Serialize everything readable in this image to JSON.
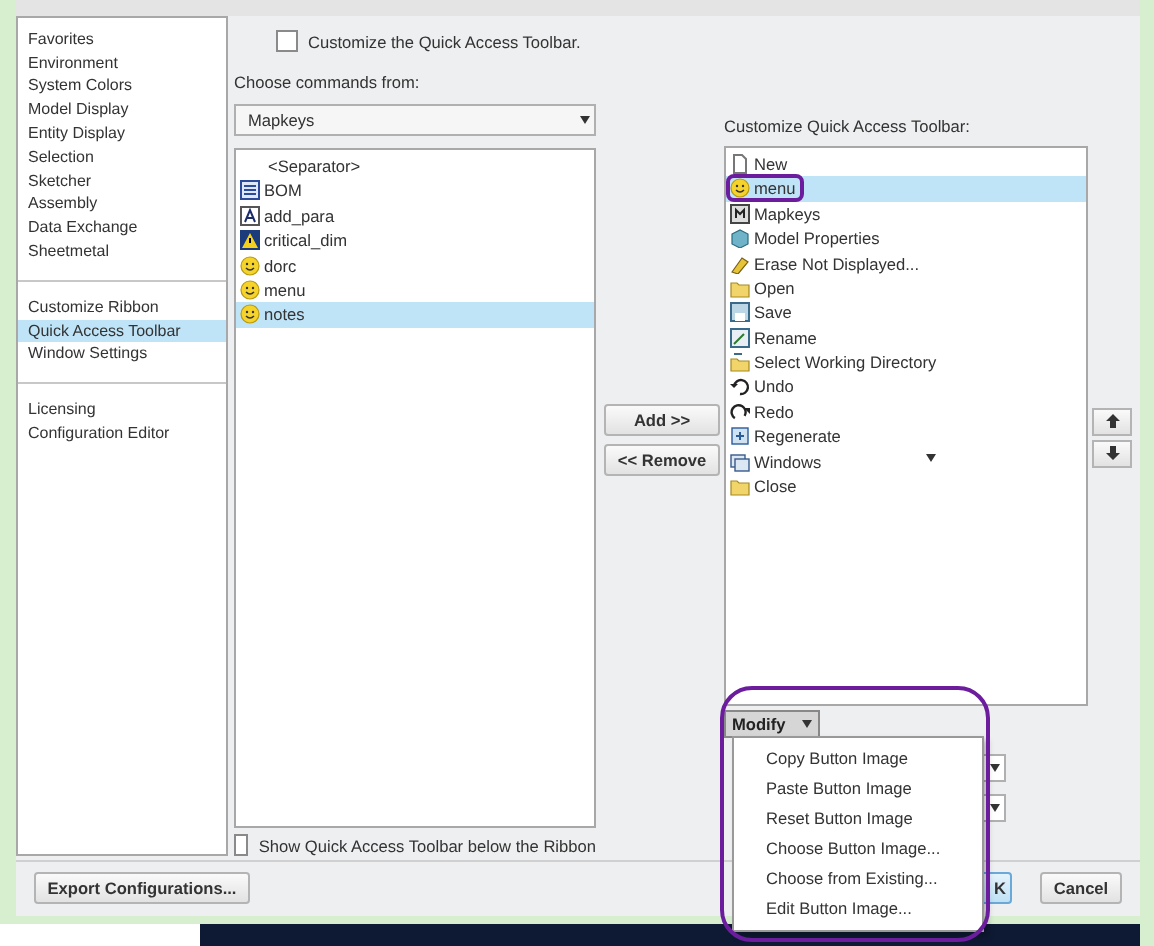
{
  "sidebar": {
    "groups": [
      {
        "items": [
          {
            "label": "Favorites",
            "selected": false
          },
          {
            "label": "Environment",
            "selected": false
          },
          {
            "label": "System Colors",
            "selected": false
          },
          {
            "label": "Model Display",
            "selected": false
          },
          {
            "label": "Entity Display",
            "selected": false
          },
          {
            "label": "Selection",
            "selected": false
          },
          {
            "label": "Sketcher",
            "selected": false
          },
          {
            "label": "Assembly",
            "selected": false
          },
          {
            "label": "Data Exchange",
            "selected": false
          },
          {
            "label": "Sheetmetal",
            "selected": false
          }
        ]
      },
      {
        "items": [
          {
            "label": "Customize Ribbon",
            "selected": false
          },
          {
            "label": "Quick Access Toolbar",
            "selected": true
          },
          {
            "label": "Window Settings",
            "selected": false
          }
        ]
      },
      {
        "items": [
          {
            "label": "Licensing",
            "selected": false
          },
          {
            "label": "Configuration Editor",
            "selected": false
          }
        ]
      }
    ]
  },
  "customize_checkbox": {
    "label": "Customize the Quick Access Toolbar.",
    "checked": false
  },
  "commands_label": "Choose commands from:",
  "commands_dropdown": {
    "value": "Mapkeys"
  },
  "commands_list": [
    {
      "label": "<Separator>",
      "kind": "separator",
      "selected": false
    },
    {
      "label": "BOM",
      "kind": "bom",
      "selected": false
    },
    {
      "label": "add_para",
      "kind": "para",
      "selected": false
    },
    {
      "label": "critical_dim",
      "kind": "warning",
      "selected": false
    },
    {
      "label": "dorc",
      "kind": "smiley",
      "selected": false
    },
    {
      "label": "menu",
      "kind": "smiley",
      "selected": false
    },
    {
      "label": "notes",
      "kind": "smiley",
      "selected": true
    }
  ],
  "add_button": "Add >>",
  "remove_button": "<< Remove",
  "toolbar_label": "Customize Quick Access Toolbar:",
  "toolbar_list": [
    {
      "label": "New",
      "kind": "document",
      "selected": false,
      "circled": false,
      "submenu": false
    },
    {
      "label": "menu",
      "kind": "smiley",
      "selected": true,
      "circled": true,
      "submenu": false
    },
    {
      "label": "Mapkeys",
      "kind": "mapkey",
      "selected": false,
      "circled": false,
      "submenu": false
    },
    {
      "label": "Model Properties",
      "kind": "properties",
      "selected": false,
      "circled": false,
      "submenu": false
    },
    {
      "label": "Erase Not Displayed...",
      "kind": "erase",
      "selected": false,
      "circled": false,
      "submenu": false
    },
    {
      "label": "Open",
      "kind": "folder",
      "selected": false,
      "circled": false,
      "submenu": false
    },
    {
      "label": "Save",
      "kind": "save",
      "selected": false,
      "circled": false,
      "submenu": false
    },
    {
      "label": "Rename",
      "kind": "rename",
      "selected": false,
      "circled": false,
      "submenu": false
    },
    {
      "label": "Select Working Directory",
      "kind": "directory",
      "selected": false,
      "circled": false,
      "submenu": false
    },
    {
      "label": "Undo",
      "kind": "undo",
      "selected": false,
      "circled": false,
      "submenu": false
    },
    {
      "label": "Redo",
      "kind": "redo",
      "selected": false,
      "circled": false,
      "submenu": false
    },
    {
      "label": "Regenerate",
      "kind": "regenerate",
      "selected": false,
      "circled": false,
      "submenu": false
    },
    {
      "label": "Windows",
      "kind": "windows",
      "selected": false,
      "circled": false,
      "submenu": true
    },
    {
      "label": "Close",
      "kind": "folder",
      "selected": false,
      "circled": false,
      "submenu": false
    }
  ],
  "modify_button": "Modify",
  "modify_menu": {
    "circled": true,
    "items": [
      "Copy Button Image",
      "Paste Button Image",
      "Reset Button Image",
      "Choose Button Image...",
      "Choose from Existing...",
      "Edit Button Image..."
    ]
  },
  "below_ribbon_checkbox": {
    "label": "Show Quick Access Toolbar below the Ribbon",
    "checked": false
  },
  "export_button": "Export Configurations...",
  "ok_button": "K",
  "cancel_button": "Cancel"
}
